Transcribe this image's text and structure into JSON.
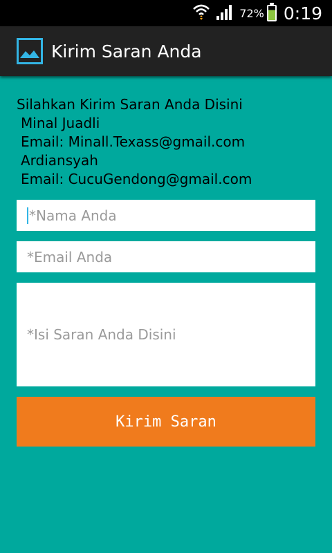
{
  "status_bar": {
    "battery_percent": "72%",
    "time": "0:19",
    "battery_level": 0.72
  },
  "action_bar": {
    "title": "Kirim Saran Anda",
    "icon": "image-icon"
  },
  "info": {
    "line1": "Silahkan Kirim Saran Anda Disini",
    "line2": "Minal Juadli",
    "line3": "Email: Minall.Texass@gmail.com",
    "line4": "Ardiansyah",
    "line5": "Email: CucuGendong@gmail.com"
  },
  "form": {
    "name_placeholder": "*Nama Anda",
    "email_placeholder": "*Email Anda",
    "message_placeholder": "*Isi Saran Anda Disini",
    "submit_label": "Kirim Saran"
  },
  "colors": {
    "background": "#00a99d",
    "button": "#f07b1d",
    "action_bar": "#222222",
    "accent": "#33b5e5"
  }
}
